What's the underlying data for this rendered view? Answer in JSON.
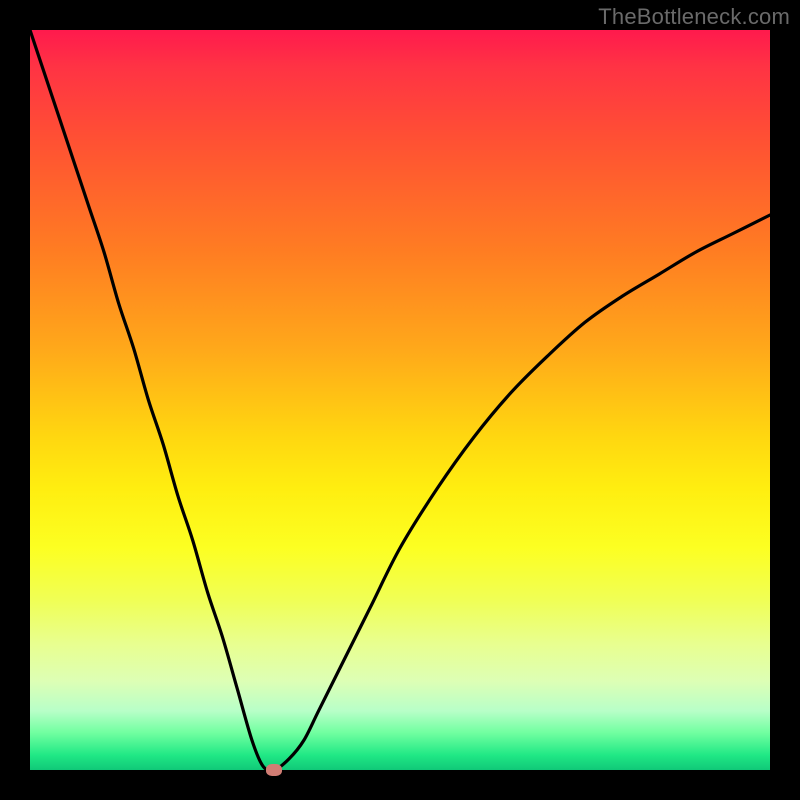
{
  "watermark": "TheBottleneck.com",
  "chart_data": {
    "type": "line",
    "title": "",
    "xlabel": "",
    "ylabel": "",
    "xlim": [
      0,
      100
    ],
    "ylim": [
      0,
      100
    ],
    "series": [
      {
        "name": "bottleneck-curve",
        "x": [
          0,
          2,
          4,
          6,
          8,
          10,
          12,
          14,
          16,
          18,
          20,
          22,
          24,
          26,
          28,
          30,
          31.5,
          33,
          35,
          37,
          39,
          42,
          46,
          50,
          55,
          60,
          65,
          70,
          75,
          80,
          85,
          90,
          95,
          100
        ],
        "y": [
          100,
          94,
          88,
          82,
          76,
          70,
          63,
          57,
          50,
          44,
          37,
          31,
          24,
          18,
          11,
          4,
          0.5,
          0,
          1.5,
          4,
          8,
          14,
          22,
          30,
          38,
          45,
          51,
          56,
          60.5,
          64,
          67,
          70,
          72.5,
          75
        ]
      }
    ],
    "optimum": {
      "x": 33,
      "y": 0
    },
    "colors": {
      "curve": "#000000",
      "marker": "#d17d74",
      "gradient_top": "#ff1a4d",
      "gradient_bottom": "#10c878"
    }
  }
}
